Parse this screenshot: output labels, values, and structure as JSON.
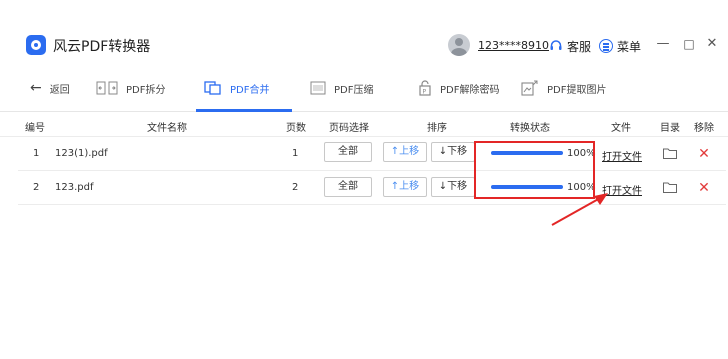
{
  "app": {
    "title": "风云PDF转换器",
    "user": "123****8910",
    "support_label": "客服",
    "menu_label": "菜单",
    "minimize": "—",
    "maximize": "□",
    "close": "✕"
  },
  "toolbar": {
    "back_label": "返回",
    "items": [
      {
        "label": "PDF拆分",
        "icon": "split-icon"
      },
      {
        "label": "PDF合并",
        "icon": "merge-icon",
        "active": true
      },
      {
        "label": "PDF压缩",
        "icon": "compress-icon"
      },
      {
        "label": "PDF解除密码",
        "icon": "unlock-icon"
      },
      {
        "label": "PDF提取图片",
        "icon": "extract-image-icon"
      }
    ]
  },
  "table": {
    "headers": {
      "index": "编号",
      "filename": "文件名称",
      "pages": "页数",
      "page_select": "页码选择",
      "sort": "排序",
      "status": "转换状态",
      "file": "文件",
      "folder": "目录",
      "remove": "移除"
    },
    "rows": [
      {
        "index": "1",
        "filename": "123(1).pdf",
        "pages": "1",
        "page_select": "全部",
        "move_up": "↑上移",
        "move_down": "↓下移",
        "progress": 100,
        "progress_text": "100%",
        "open_file": "打开文件"
      },
      {
        "index": "2",
        "filename": "123.pdf",
        "pages": "2",
        "page_select": "全部",
        "move_up": "↑上移",
        "move_down": "↓下移",
        "progress": 100,
        "progress_text": "100%",
        "open_file": "打开文件"
      }
    ]
  },
  "colors": {
    "accent": "#2b6cf0",
    "annotation": "#e32626",
    "delete": "#e23b3b"
  }
}
